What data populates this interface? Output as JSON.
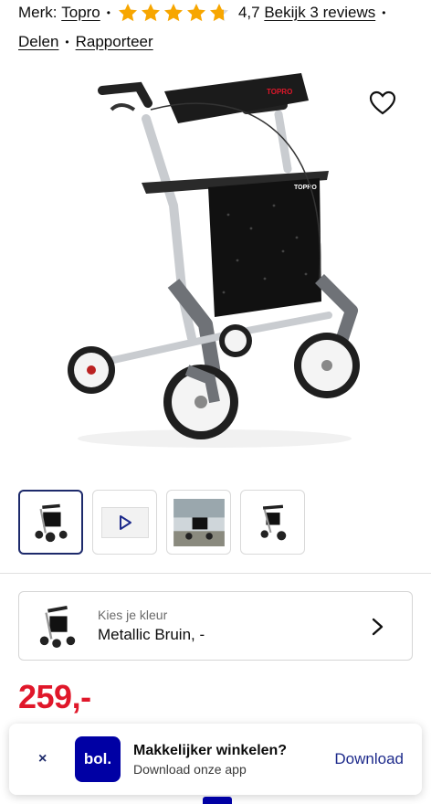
{
  "meta": {
    "brand_prefix": "Merk:",
    "brand": "Topro",
    "rating": "4,7",
    "rating_value": 4.7,
    "reviews_link": "Bekijk 3 reviews",
    "share": "Delen",
    "report": "Rapporteer"
  },
  "product": {
    "image_label": "TOPRO",
    "thumbnails": [
      {
        "kind": "image",
        "active": true
      },
      {
        "kind": "video",
        "active": false
      },
      {
        "kind": "image",
        "active": false
      },
      {
        "kind": "image",
        "active": false
      }
    ]
  },
  "color_select": {
    "label": "Kies je kleur",
    "value": "Metallic Bruin, -"
  },
  "price": "259,-",
  "app_banner": {
    "close": "×",
    "logo": "bol.",
    "title": "Makkelijker winkelen?",
    "subtitle": "Download onze app",
    "action": "Download"
  },
  "colors": {
    "star": "#f7a600",
    "price": "#e0172a",
    "brand_blue": "#0000a4",
    "active_border": "#1d2a6b"
  },
  "icons": [
    "star-icon",
    "heart-icon",
    "play-icon",
    "chevron-right-icon",
    "close-icon"
  ]
}
